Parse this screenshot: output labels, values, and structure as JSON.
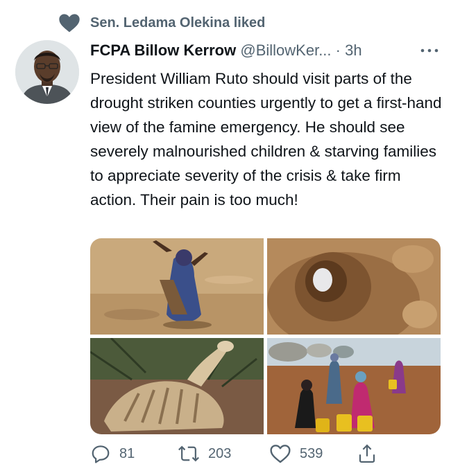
{
  "social_context": {
    "text": "Sen. Ledama Olekina liked",
    "icon": "heart-icon"
  },
  "tweet": {
    "author_name": "FCPA Billow Kerrow",
    "handle": "@BillowKer...",
    "separator": "·",
    "time": "3h",
    "more_icon": "more-dots-icon",
    "text": "President William Ruto should visit parts of the drought striken counties urgently to get a first-hand view of the famine emergency. He should see severely malnourished children & starving families to appreciate severity of the crisis & take firm action. Their pain is too much!",
    "media": [
      {
        "name": "photo-woman-on-dry-ground"
      },
      {
        "name": "photo-dry-well"
      },
      {
        "name": "photo-animal-carcass"
      },
      {
        "name": "photo-women-water-jerrycans"
      }
    ]
  },
  "actions": {
    "replies": "81",
    "retweets": "203",
    "likes": "539"
  },
  "colors": {
    "text": "#0f1419",
    "secondary": "#536471"
  }
}
